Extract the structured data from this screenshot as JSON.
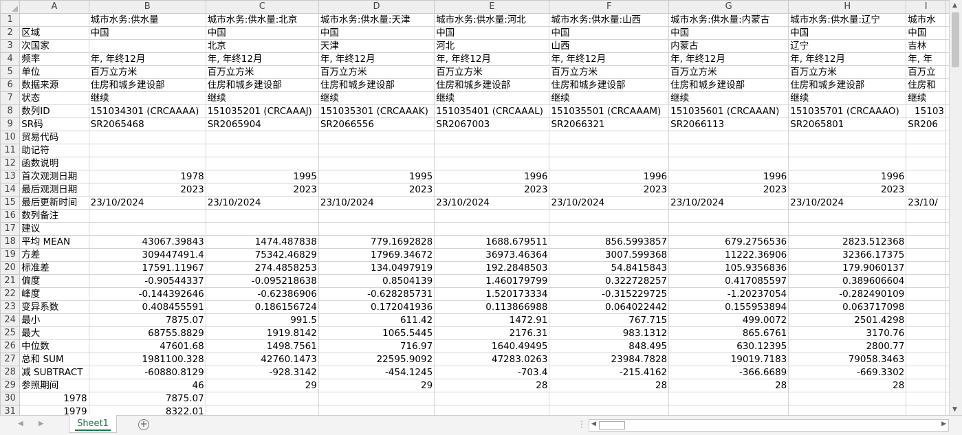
{
  "columns": [
    "A",
    "B",
    "C",
    "D",
    "E",
    "F",
    "G",
    "H",
    "I"
  ],
  "rows": [
    {
      "n": "1",
      "a": "",
      "b": "城市水务:供水量",
      "c": "城市水务:供水量:北京",
      "d": "城市水务:供水量:天津",
      "e": "城市水务:供水量:河北",
      "f": "城市水务:供水量:山西",
      "g": "城市水务:供水量:内蒙古",
      "h": "城市水务:供水量:辽宁",
      "i": "城市水"
    },
    {
      "n": "2",
      "a": "区域",
      "b": "中国",
      "c": "中国",
      "d": "中国",
      "e": "中国",
      "f": "中国",
      "g": "中国",
      "h": "中国",
      "i": "中国"
    },
    {
      "n": "3",
      "a": "次国家",
      "b": "",
      "c": "北京",
      "d": "天津",
      "e": "河北",
      "f": "山西",
      "g": "内蒙古",
      "h": "辽宁",
      "i": "吉林"
    },
    {
      "n": "4",
      "a": "频率",
      "b": "年, 年终12月",
      "c": "年, 年终12月",
      "d": "年, 年终12月",
      "e": "年, 年终12月",
      "f": "年, 年终12月",
      "g": "年, 年终12月",
      "h": "年, 年终12月",
      "i": "年, 年"
    },
    {
      "n": "5",
      "a": "单位",
      "b": "百万立方米",
      "c": "百万立方米",
      "d": "百万立方米",
      "e": "百万立方米",
      "f": "百万立方米",
      "g": "百万立方米",
      "h": "百万立方米",
      "i": "百万立"
    },
    {
      "n": "6",
      "a": "数据来源",
      "b": "住房和城乡建设部",
      "c": "住房和城乡建设部",
      "d": "住房和城乡建设部",
      "e": "住房和城乡建设部",
      "f": "住房和城乡建设部",
      "g": "住房和城乡建设部",
      "h": "住房和城乡建设部",
      "i": "住房和"
    },
    {
      "n": "7",
      "a": "状态",
      "b": "继续",
      "c": "继续",
      "d": "继续",
      "e": "继续",
      "f": "继续",
      "g": "继续",
      "h": "继续",
      "i": "继续"
    },
    {
      "n": "8",
      "a": "数列ID",
      "b": "151034301 (CRCAAAA)",
      "c": "151035201 (CRCAAAJ)",
      "d": "151035301 (CRCAAAK)",
      "e": "151035401 (CRCAAAL)",
      "f": "151035501 (CRCAAAM)",
      "g": "151035601 (CRCAAAN)",
      "h": "151035701 (CRCAAAO)",
      "i": "15103"
    },
    {
      "n": "9",
      "a": "SR码",
      "b": "SR2065468",
      "c": "SR2065904",
      "d": "SR2066556",
      "e": "SR2067003",
      "f": "SR2066321",
      "g": "SR2066113",
      "h": "SR2065801",
      "i": "SR206"
    },
    {
      "n": "10",
      "a": "贸易代码",
      "b": "",
      "c": "",
      "d": "",
      "e": "",
      "f": "",
      "g": "",
      "h": "",
      "i": ""
    },
    {
      "n": "11",
      "a": "助记符",
      "b": "",
      "c": "",
      "d": "",
      "e": "",
      "f": "",
      "g": "",
      "h": "",
      "i": ""
    },
    {
      "n": "12",
      "a": "函数说明",
      "b": "",
      "c": "",
      "d": "",
      "e": "",
      "f": "",
      "g": "",
      "h": "",
      "i": ""
    },
    {
      "n": "13",
      "a": "首次观测日期",
      "b": "1978",
      "c": "1995",
      "d": "1995",
      "e": "1996",
      "f": "1996",
      "g": "1996",
      "h": "1996",
      "i": ""
    },
    {
      "n": "14",
      "a": "最后观测日期",
      "b": "2023",
      "c": "2023",
      "d": "2023",
      "e": "2023",
      "f": "2023",
      "g": "2023",
      "h": "2023",
      "i": ""
    },
    {
      "n": "15",
      "a": "最后更新时间",
      "b": "23/10/2024",
      "c": "23/10/2024",
      "d": "23/10/2024",
      "e": "23/10/2024",
      "f": "23/10/2024",
      "g": "23/10/2024",
      "h": "23/10/2024",
      "i": "23/10/"
    },
    {
      "n": "16",
      "a": "数列备注",
      "b": "",
      "c": "",
      "d": "",
      "e": "",
      "f": "",
      "g": "",
      "h": "",
      "i": ""
    },
    {
      "n": "17",
      "a": "建议",
      "b": "",
      "c": "",
      "d": "",
      "e": "",
      "f": "",
      "g": "",
      "h": "",
      "i": ""
    },
    {
      "n": "18",
      "a": "平均 MEAN",
      "b": "43067.39843",
      "c": "1474.487838",
      "d": "779.1692828",
      "e": "1688.679511",
      "f": "856.5993857",
      "g": "679.2756536",
      "h": "2823.512368",
      "i": ""
    },
    {
      "n": "19",
      "a": "方差",
      "b": "309447491.4",
      "c": "75342.46829",
      "d": "17969.34672",
      "e": "36973.46364",
      "f": "3007.599368",
      "g": "11222.36906",
      "h": "32366.17375",
      "i": ""
    },
    {
      "n": "20",
      "a": "标准差",
      "b": "17591.11967",
      "c": "274.4858253",
      "d": "134.0497919",
      "e": "192.2848503",
      "f": "54.8415843",
      "g": "105.9356836",
      "h": "179.9060137",
      "i": ""
    },
    {
      "n": "21",
      "a": "偏度",
      "b": "-0.90544337",
      "c": "-0.095218638",
      "d": "0.8504139",
      "e": "1.460179799",
      "f": "0.322728257",
      "g": "0.417085597",
      "h": "0.389606604",
      "i": ""
    },
    {
      "n": "22",
      "a": "峰度",
      "b": "-0.144392646",
      "c": "-0.62386906",
      "d": "-0.628285731",
      "e": "1.520173334",
      "f": "-0.315229725",
      "g": "-1.20237054",
      "h": "-0.282490109",
      "i": ""
    },
    {
      "n": "23",
      "a": "变异系数",
      "b": "0.408455591",
      "c": "0.186156724",
      "d": "0.172041936",
      "e": "0.113866988",
      "f": "0.064022442",
      "g": "0.155953894",
      "h": "0.063717098",
      "i": ""
    },
    {
      "n": "24",
      "a": "最小",
      "b": "7875.07",
      "c": "991.5",
      "d": "611.42",
      "e": "1472.91",
      "f": "767.715",
      "g": "499.0072",
      "h": "2501.4298",
      "i": ""
    },
    {
      "n": "25",
      "a": "最大",
      "b": "68755.8829",
      "c": "1919.8142",
      "d": "1065.5445",
      "e": "2176.31",
      "f": "983.1312",
      "g": "865.6761",
      "h": "3170.76",
      "i": ""
    },
    {
      "n": "26",
      "a": "中位数",
      "b": "47601.68",
      "c": "1498.7561",
      "d": "716.97",
      "e": "1640.49495",
      "f": "848.495",
      "g": "630.12395",
      "h": "2800.77",
      "i": ""
    },
    {
      "n": "27",
      "a": "总和 SUM",
      "b": "1981100.328",
      "c": "42760.1473",
      "d": "22595.9092",
      "e": "47283.0263",
      "f": "23984.7828",
      "g": "19019.7183",
      "h": "79058.3463",
      "i": ""
    },
    {
      "n": "28",
      "a": "减 SUBTRACT",
      "b": "-60880.8129",
      "c": "-928.3142",
      "d": "-454.1245",
      "e": "-703.4",
      "f": "-215.4162",
      "g": "-366.6689",
      "h": "-669.3302",
      "i": ""
    },
    {
      "n": "29",
      "a": "参照期间",
      "b": "46",
      "c": "29",
      "d": "29",
      "e": "28",
      "f": "28",
      "g": "28",
      "h": "28",
      "i": ""
    },
    {
      "n": "30",
      "a": "1978",
      "b": "7875.07",
      "c": "",
      "d": "",
      "e": "",
      "f": "",
      "g": "",
      "h": "",
      "i": ""
    },
    {
      "n": "31",
      "a": "1979",
      "b": "8322.01",
      "c": "",
      "d": "",
      "e": "",
      "f": "",
      "g": "",
      "h": "",
      "i": ""
    }
  ],
  "sheet_tabs": [
    {
      "label": "Sheet1",
      "active": true
    }
  ],
  "icons": {
    "nav_prev": "triangle-left-icon",
    "nav_next": "triangle-right-icon",
    "add_sheet": "plus-circle-icon",
    "more": "ellipsis-icon"
  },
  "colors": {
    "accent": "#217346",
    "grid": "#d4d4d4",
    "header_bg": "#efefef"
  }
}
